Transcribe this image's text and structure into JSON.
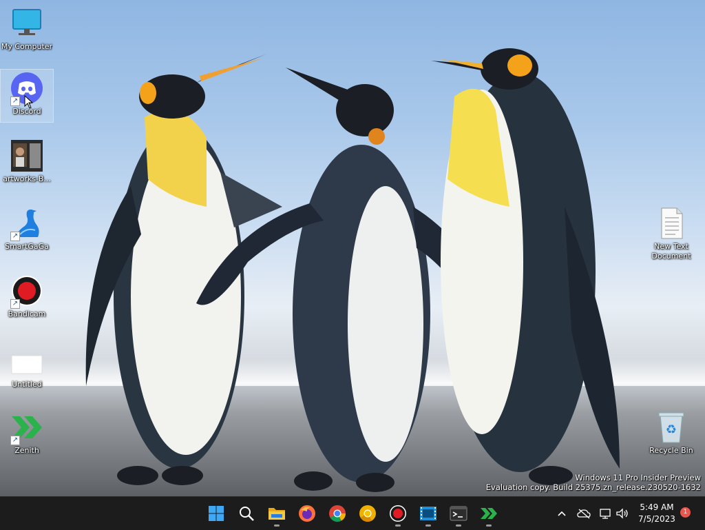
{
  "desktop": {
    "icons_left": [
      {
        "label": "My Computer",
        "icon": "monitor-icon",
        "shortcut": false
      },
      {
        "label": "Discord",
        "icon": "discord-icon",
        "shortcut": true
      },
      {
        "label": "artworks-B...",
        "icon": "image-thumbnail-icon",
        "shortcut": false
      },
      {
        "label": "SmartGaGa",
        "icon": "swan-icon",
        "shortcut": true
      },
      {
        "label": "Bandicam",
        "icon": "record-icon",
        "shortcut": true
      },
      {
        "label": "Untitled",
        "icon": "blank-file-icon",
        "shortcut": false
      },
      {
        "label": "Zenith",
        "icon": "double-chevron-icon",
        "shortcut": true
      }
    ],
    "icons_right": [
      {
        "label": "New Text Document",
        "label_line1": "New Text",
        "label_line2": "Document",
        "icon": "text-document-icon"
      },
      {
        "label": "Recycle Bin",
        "icon": "recycle-bin-icon"
      }
    ],
    "watermark": {
      "line1": "Windows 11 Pro Insider Preview",
      "line2": "Evaluation copy. Build 25375.zn_release.230520-1632"
    }
  },
  "taskbar": {
    "apps": [
      {
        "name": "start",
        "icon": "windows-start-icon",
        "running": false
      },
      {
        "name": "search",
        "icon": "search-icon",
        "running": false
      },
      {
        "name": "file-explorer",
        "icon": "folder-icon",
        "running": true
      },
      {
        "name": "firefox",
        "icon": "firefox-icon",
        "running": false
      },
      {
        "name": "chrome",
        "icon": "chrome-icon",
        "running": false
      },
      {
        "name": "chrome-canary",
        "icon": "chrome-canary-icon",
        "running": false
      },
      {
        "name": "bandicam",
        "icon": "record-icon",
        "running": true
      },
      {
        "name": "video-editor",
        "icon": "film-icon",
        "running": true
      },
      {
        "name": "terminal",
        "icon": "terminal-icon",
        "running": true
      },
      {
        "name": "zenith",
        "icon": "double-chevron-icon",
        "running": true
      }
    ],
    "tray": {
      "time": "5:49 AM",
      "date": "7/5/2023",
      "notification_count": "1"
    }
  },
  "colors": {
    "taskbar": "#1c1c1c",
    "discord": "#5865f2",
    "bandicam_red": "#e01b24",
    "zenith_green": "#2bb24c",
    "notification": "#e8574f"
  }
}
